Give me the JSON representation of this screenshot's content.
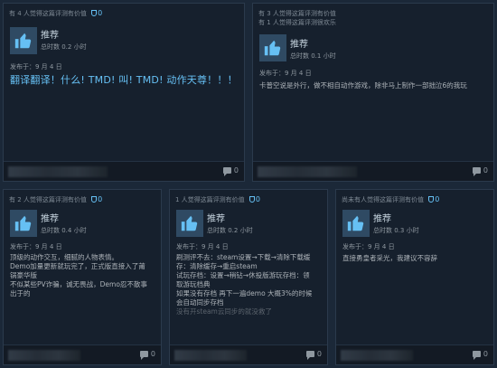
{
  "reviews": [
    {
      "helpful": "有 4 人觉得这篇评测有价值",
      "award_count": "0",
      "verdict": "推荐",
      "hours": "总时数 0.2 小时",
      "posted": "发布于：9 月 4 日",
      "body": [
        "翻译翻译！什么! TMD! 叫! TMD! 动作天尊！！！"
      ],
      "comments": "0"
    },
    {
      "helpful": "有 3 人觉得这篇评测有价值",
      "helpful2": "有 1 人觉得这篇评测很欢乐",
      "award_count": "",
      "verdict": "推荐",
      "hours": "总时数 0.1 小时",
      "posted": "发布于：9 月 4 日",
      "body": [
        "卡普空说是外行，做不相自动作游戏，除非马上制作一部拙泣6的我玩"
      ],
      "comments": "0"
    },
    {
      "helpful": "有 2 人觉得这篇评测有价值",
      "award_count": "0",
      "verdict": "推荐",
      "hours": "总时数 0.4 小时",
      "posted": "发布于：9 月 4 日",
      "body": [
        "顶级的动作交互，细腻的人物表情。",
        "Demo加量更新就玩完了，正式版直接入了莆",
        "锅豪华版",
        "不似某些PV诈骗，诚无畏战，Demo忍不散事",
        "出于的"
      ],
      "comments": "0"
    },
    {
      "helpful": "1 人觉得这篇评测有价值",
      "award_count": "0",
      "verdict": "推荐",
      "hours": "总时数 0.2 小时",
      "posted": "发布于：9 月 4 日",
      "body": [
        "刷测评不去：steam设置→下载→清除下载缓",
        "存：清除缓存→重启steam",
        "试玩存档：设置→稍钻→休投版游玩存档：领",
        "取游玩档典",
        "如果没有存档 再下一遍demo 大概3%的时候",
        "会自动同步存档",
        "没有开steam云同步的就没救了"
      ],
      "comments": "0"
    },
    {
      "helpful": "尚未有人觉得这篇评测有价值",
      "award_count": "0",
      "verdict": "推荐",
      "hours": "总时数 0.3 小时",
      "posted": "发布于：9 月 4 日",
      "body": [
        "直接勇皇者采光，我建议不容辞"
      ],
      "comments": "0"
    }
  ],
  "colors": {
    "background": "#1b2838",
    "card": "#16202d",
    "accent": "#66c0f4",
    "thumb_bg": "#2f4a63"
  },
  "icons": {
    "thumb": "thumbs-up-icon",
    "award": "award-icon",
    "comment": "comment-icon"
  }
}
